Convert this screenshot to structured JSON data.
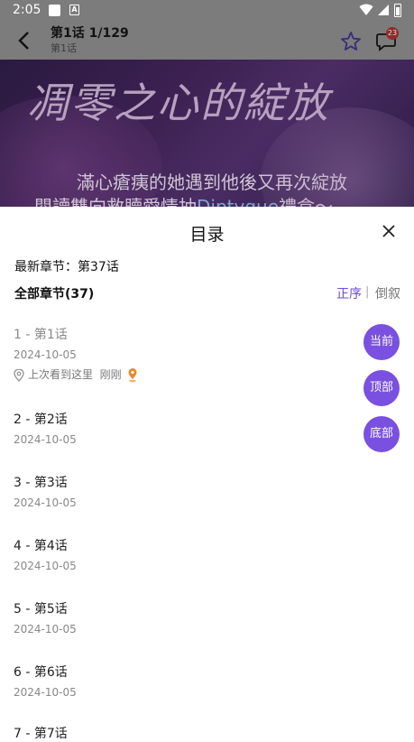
{
  "status_bar": {
    "time": "2:05"
  },
  "header": {
    "title": "第1话  1/129",
    "subtitle": "第1话",
    "comment_count": "23"
  },
  "banner": {
    "title": "凋零之心的綻放",
    "line1": "滿心瘡痍的她遇到他後又再次綻放",
    "line2_prefix": "閱讀雙向救贖愛情抽",
    "line2_highlight": "Diptyque",
    "line2_suffix": "禮盒～"
  },
  "sheet": {
    "title": "目录",
    "latest_label": "最新章节：第37话",
    "all_label": "全部章节(37)",
    "sort_asc": "正序",
    "sort_sep": "|",
    "sort_desc": "倒叙",
    "last_read_text": "上次看到这里",
    "last_read_time": "刚刚"
  },
  "chapters": [
    {
      "title": "1 - 第1话",
      "date": "2024-10-05"
    },
    {
      "title": "2 - 第2话",
      "date": "2024-10-05"
    },
    {
      "title": "3 - 第3话",
      "date": "2024-10-05"
    },
    {
      "title": "4 - 第4话",
      "date": "2024-10-05"
    },
    {
      "title": "5 - 第5话",
      "date": "2024-10-05"
    },
    {
      "title": "6 - 第6话",
      "date": "2024-10-05"
    },
    {
      "title": "7 - 第7话",
      "date": ""
    }
  ],
  "fabs": {
    "current": "当前",
    "top": "顶部",
    "bottom": "底部"
  },
  "colors": {
    "accent": "#7a50e0",
    "overlay": "#7c7c7c"
  }
}
